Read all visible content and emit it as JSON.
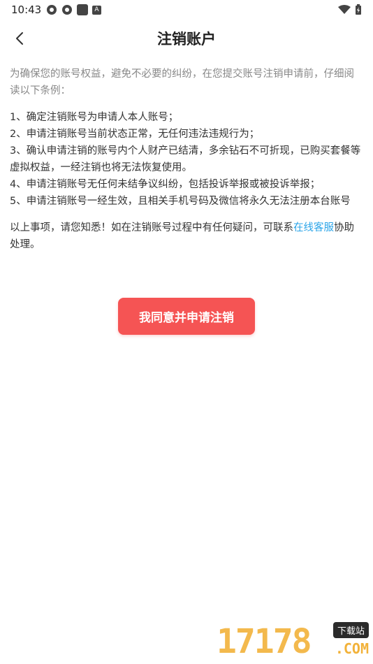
{
  "status_bar": {
    "time": "10:43",
    "icons": [
      "notification-icon",
      "notification-icon",
      "app-icon",
      "a-icon",
      "wifi-icon",
      "battery-icon"
    ],
    "a_label": "A"
  },
  "header": {
    "title": "注销账户",
    "back_icon": "chevron-left-icon"
  },
  "content": {
    "intro": "为确保您的账号权益，避免不必要的纠纷，在您提交账号注销申请前，仔细阅读以下条例：",
    "terms": [
      "1、确定注销账号为申请人本人账号；",
      "2、申请注销账号当前状态正常，无任何违法违规行为；",
      "3、确认申请注销的账号内个人财产已结清，多余钻石不可折现，已购买套餐等虚拟权益，一经注销也将无法恢复使用。",
      "4、申请注销账号无任何未结争议纠纷，包括投诉举报或被投诉举报；",
      "5、申请注销账号一经生效，且相关手机号码及微信将永久无法注册本台账号"
    ],
    "contact_prefix": "以上事项，请您知悉！如在注销账号过程中有任何疑问，可联系",
    "contact_link": "在线客服",
    "contact_suffix": "协助处理。"
  },
  "actions": {
    "agree_label": "我同意并申请注销"
  },
  "watermark": {
    "number": "17178",
    "badge": "下载站",
    "domain": ".COM"
  },
  "colors": {
    "accent": "#f55454",
    "link": "#2aa4e8",
    "intro_text": "#888888"
  }
}
